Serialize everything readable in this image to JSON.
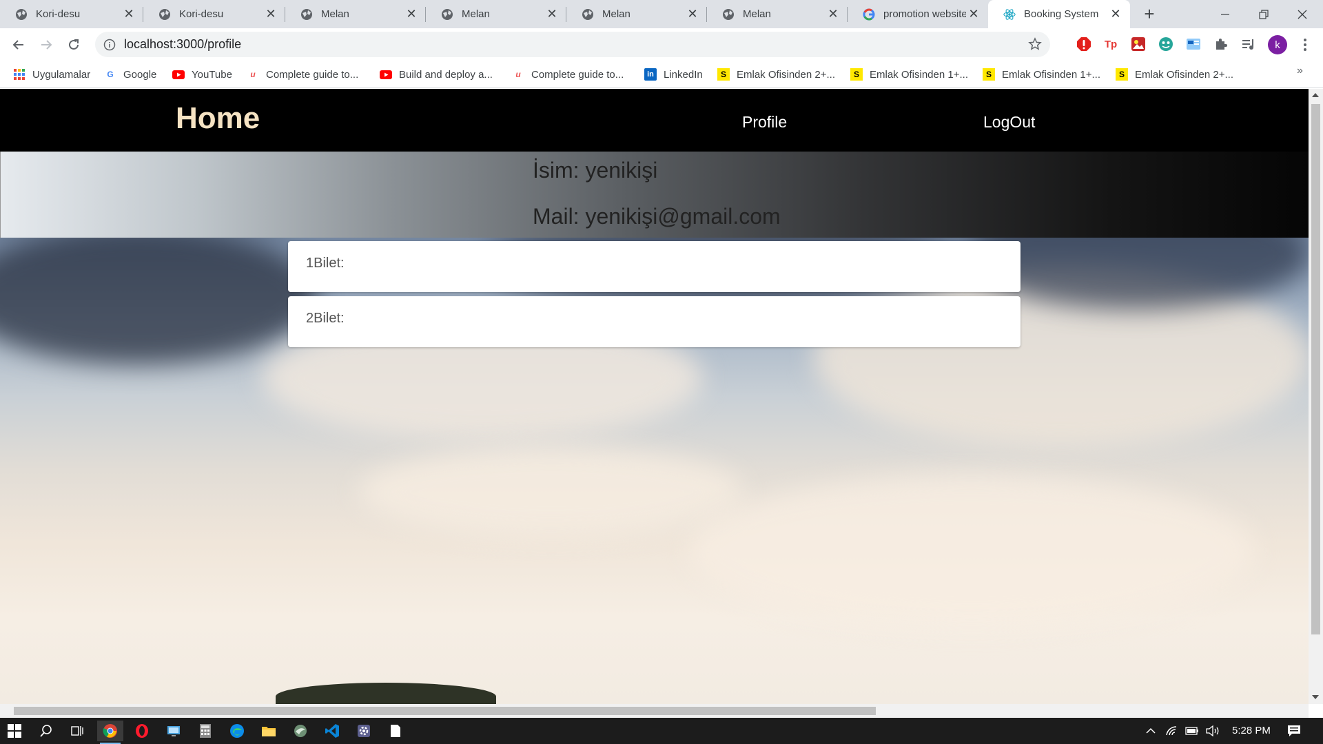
{
  "browser": {
    "tabs": [
      {
        "title": "Kori-desu",
        "icon": "globe-icon"
      },
      {
        "title": "Kori-desu",
        "icon": "globe-icon"
      },
      {
        "title": "Melan",
        "icon": "globe-icon"
      },
      {
        "title": "Melan",
        "icon": "globe-icon"
      },
      {
        "title": "Melan",
        "icon": "globe-icon"
      },
      {
        "title": "Melan",
        "icon": "globe-icon"
      },
      {
        "title": "promotion website",
        "icon": "google-icon"
      },
      {
        "title": "Booking System",
        "icon": "react-icon",
        "active": true
      }
    ],
    "new_tab_symbol": "+",
    "address": "localhost:3000/profile",
    "avatar_letter": "k",
    "bookmarks": [
      {
        "label": "Uygulamalar",
        "icon": "apps-grid-icon"
      },
      {
        "label": "Google",
        "icon": "google-icon"
      },
      {
        "label": "YouTube",
        "icon": "youtube-icon"
      },
      {
        "label": "Complete guide to...",
        "icon": "udemy-icon"
      },
      {
        "label": "Build and deploy a...",
        "icon": "youtube-icon"
      },
      {
        "label": "Complete guide to...",
        "icon": "udemy-icon"
      },
      {
        "label": "LinkedIn",
        "icon": "linkedin-icon"
      },
      {
        "label": "Emlak Ofisinden 2+...",
        "icon": "sahibinden-icon"
      },
      {
        "label": "Emlak Ofisinden 1+...",
        "icon": "sahibinden-icon"
      },
      {
        "label": "Emlak Ofisinden 1+...",
        "icon": "sahibinden-icon"
      },
      {
        "label": "Emlak Ofisinden 2+...",
        "icon": "sahibinden-icon"
      }
    ],
    "bookmarks_overflow": "»"
  },
  "app": {
    "nav": {
      "home": "Home",
      "profile": "Profile",
      "logout": "LogOut"
    },
    "profile": {
      "name_line": "İsim: yenikişi",
      "mail_line": "Mail: yenikişi@gmail.com"
    },
    "tickets": [
      {
        "label": "1Bilet:"
      },
      {
        "label": "2Bilet:"
      }
    ]
  },
  "taskbar": {
    "clock": "5:28 PM"
  },
  "colors": {
    "nav_background": "#000000",
    "home_link": "#f6e3c3",
    "avatar": "#7b1fa2",
    "taskbar": "#1c1c1c"
  }
}
